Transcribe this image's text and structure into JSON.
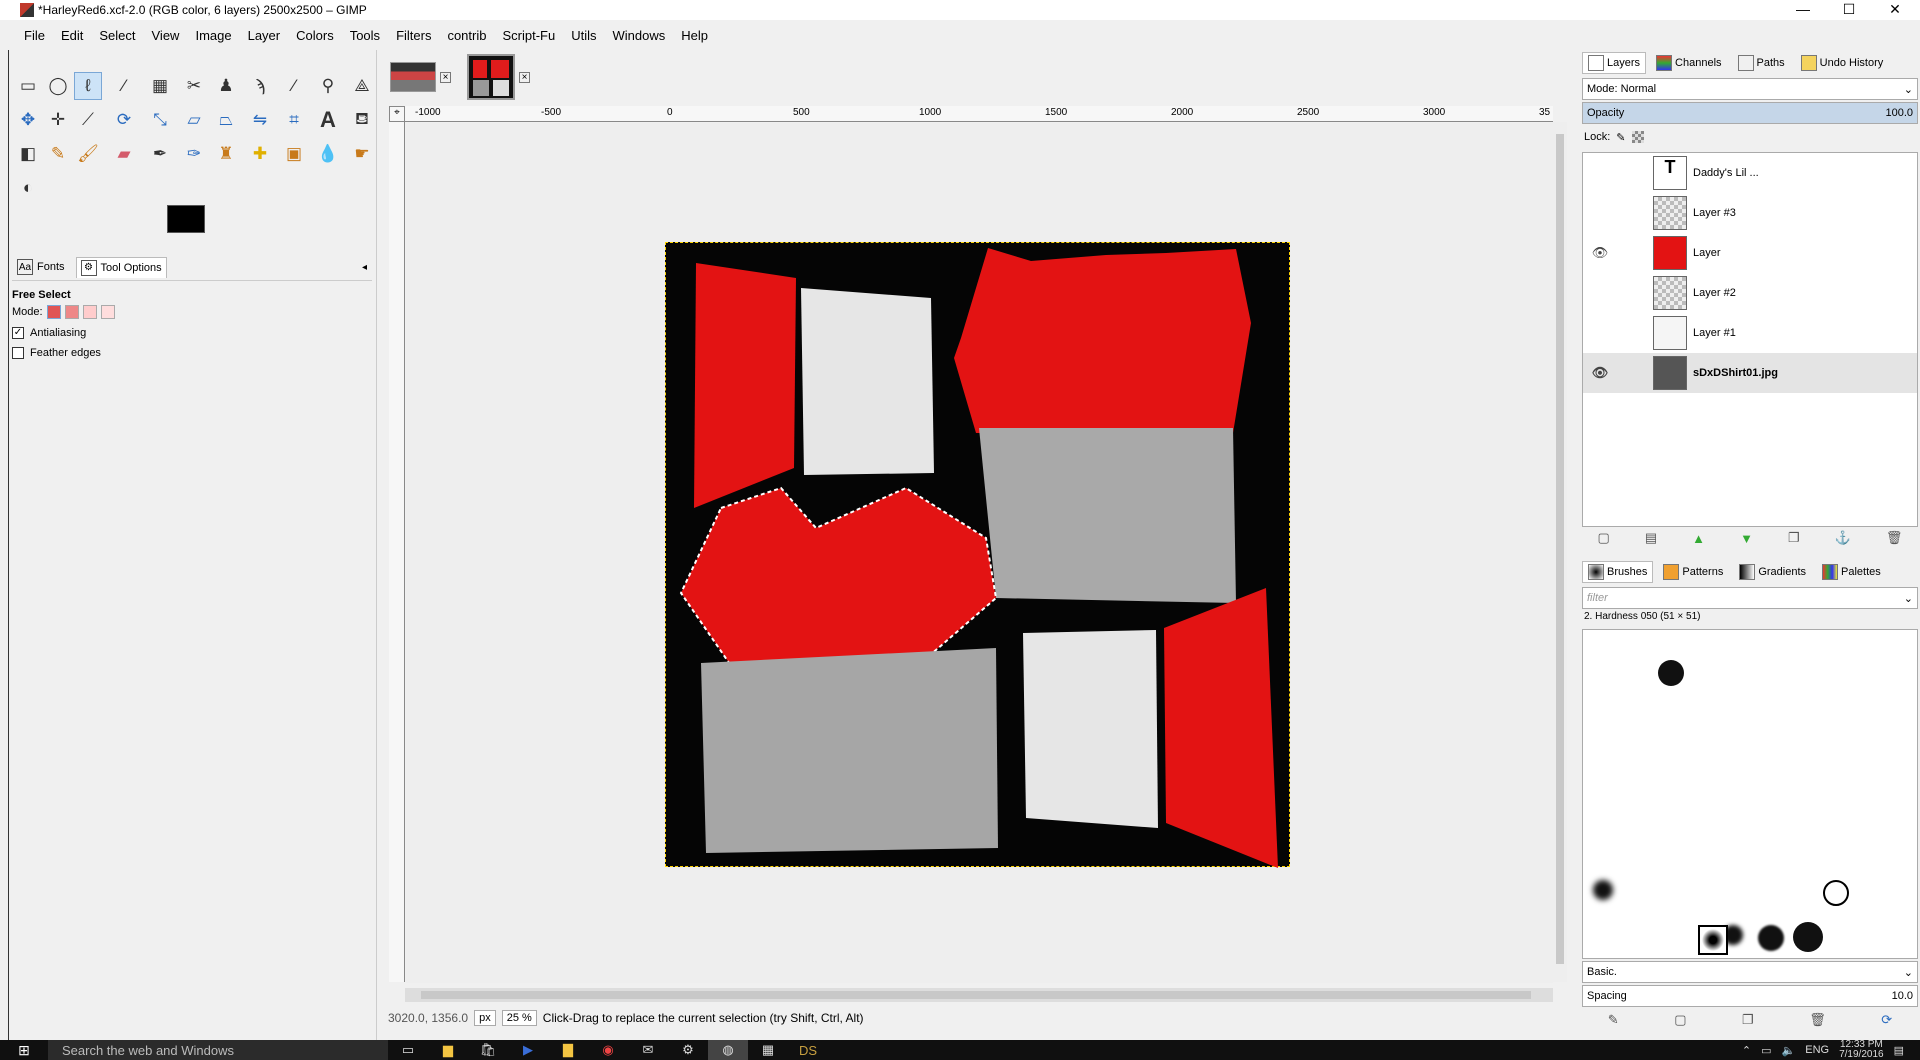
{
  "window": {
    "title": "*HarleyRed6.xcf-2.0 (RGB color, 6 layers) 2500x2500 – GIMP",
    "minimize": "—",
    "maximize": "☐",
    "close": "✕"
  },
  "menu": [
    "File",
    "Edit",
    "Select",
    "View",
    "Image",
    "Layer",
    "Colors",
    "Tools",
    "Filters",
    "contrib",
    "Script-Fu",
    "Utils",
    "Windows",
    "Help"
  ],
  "tool_options": {
    "tabs": [
      {
        "icon": "Aa",
        "label": "Fonts"
      },
      {
        "icon": "⚙",
        "label": "Tool Options"
      }
    ],
    "tool_name": "Free Select",
    "mode_label": "Mode:",
    "antialiasing": "Antialiasing",
    "feather": "Feather edges"
  },
  "ruler": [
    "-1000",
    "-500",
    "0",
    "500",
    "1000",
    "1500",
    "2000",
    "2500",
    "3000",
    "35"
  ],
  "status": {
    "coords": "3020.0, 1356.0",
    "unit": "px",
    "zoom": "25 %",
    "message": "Click-Drag to replace the current selection (try Shift, Ctrl, Alt)"
  },
  "layers_panel": {
    "tabs": [
      "Layers",
      "Channels",
      "Paths",
      "Undo History"
    ],
    "mode": "Mode: Normal",
    "opacity_label": "Opacity",
    "opacity_value": "100.0",
    "lock_label": "Lock:",
    "layers": [
      {
        "name": "Daddy's Lil ...",
        "visible": false
      },
      {
        "name": "Layer #3",
        "visible": false
      },
      {
        "name": "Layer",
        "visible": true
      },
      {
        "name": "Layer #2",
        "visible": false
      },
      {
        "name": "Layer #1",
        "visible": false
      },
      {
        "name": "sDxDShirt01.jpg",
        "visible": true
      }
    ]
  },
  "brushes_panel": {
    "tabs": [
      "Brushes",
      "Patterns",
      "Gradients",
      "Palettes"
    ],
    "filter_placeholder": "filter",
    "brush_name": "2. Hardness 050 (51 × 51)",
    "preset": "Basic.",
    "spacing_label": "Spacing",
    "spacing_value": "10.0"
  },
  "taskbar": {
    "search": "Search the web and Windows",
    "lang": "ENG",
    "time": "12:33 PM",
    "date": "7/19/2016"
  }
}
